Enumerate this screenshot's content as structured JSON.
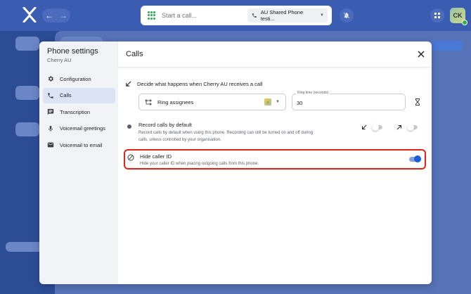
{
  "app": {
    "search": {
      "placeholder": "Start a call..."
    },
    "line_selector": {
      "label": "AU Shared Phone testi..."
    },
    "avatar_initials": "CK"
  },
  "modal": {
    "sidebar": {
      "title": "Phone settings",
      "subtitle": "Cherry AU",
      "items": [
        {
          "label": "Configuration",
          "icon": "gear-icon",
          "active": false
        },
        {
          "label": "Calls",
          "icon": "phone-icon",
          "active": true
        },
        {
          "label": "Transcription",
          "icon": "transcript-icon",
          "active": false
        },
        {
          "label": "Voicemail greetings",
          "icon": "microphone-icon",
          "active": false
        },
        {
          "label": "Voicemail to email",
          "icon": "email-icon",
          "active": false
        }
      ]
    },
    "header": {
      "title": "Calls"
    },
    "calls": {
      "decide_label": "Decide what happens when Cherry AU receives a call",
      "assignee_option": "Ring assignees",
      "ring_time": {
        "label": "Ring time (seconds)",
        "value": "30"
      },
      "record": {
        "title": "Record calls by default",
        "description": "Record calls by default when using this phone. Recording can still be turned on and off during calls, unless controlled by your organisation.",
        "inbound_on": false,
        "outbound_on": false
      },
      "hide_caller_id": {
        "title": "Hide caller ID",
        "description": "Hide your caller ID when placing outgoing calls from this phone.",
        "on": true
      }
    }
  },
  "colors": {
    "accent": "#1a5dd8",
    "highlight_border": "#e0241b",
    "topbar": "#3a5db2"
  }
}
